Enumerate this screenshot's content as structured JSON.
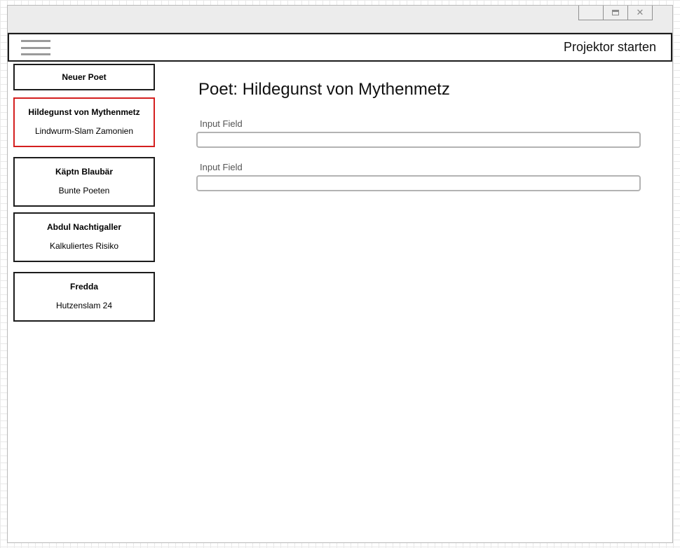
{
  "window": {
    "controls": {
      "minimize_icon": "minimize-icon",
      "maximize_icon": "maximize-icon",
      "close_icon": "close-icon",
      "close_glyph": "✕"
    }
  },
  "navbar": {
    "menu_icon": "hamburger-menu-icon",
    "projector_label": "Projektor starten"
  },
  "sidebar": {
    "new_poet_label": "Neuer Poet",
    "poets": [
      {
        "name": "Hildegunst von Mythenmetz",
        "group": "Lindwurm-Slam Zamonien",
        "selected": true
      },
      {
        "name": "Käptn Blaubär",
        "group": "Bunte Poeten",
        "selected": false
      },
      {
        "name": "Abdul Nachtigaller",
        "group": "Kalkuliertes Risiko",
        "selected": false
      },
      {
        "name": "Fredda",
        "group": "Hutzenslam 24",
        "selected": false
      }
    ]
  },
  "main": {
    "title": "Poet: Hildegunst von Mythenmetz",
    "fields": [
      {
        "label": "Input Field",
        "value": ""
      },
      {
        "label": "Input Field",
        "value": ""
      }
    ]
  },
  "colors": {
    "selected_border": "#d41f1f",
    "border": "#1c1c1c",
    "input_border": "#b3b3b3",
    "titlebar_bg": "#ececec"
  }
}
